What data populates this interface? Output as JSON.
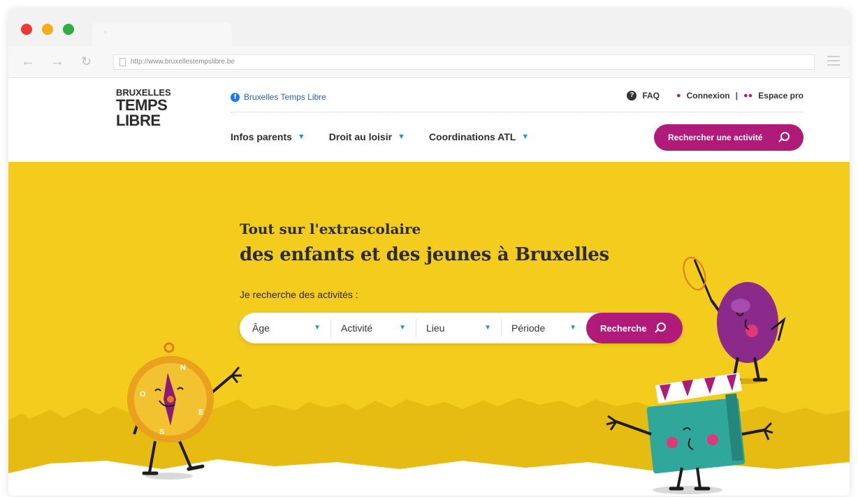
{
  "browser": {
    "url": "http://www.bruxellestempslibre.be"
  },
  "header": {
    "logo": {
      "line1": "BRUXELLES",
      "line2": "TEMPS",
      "line3": "LIBRE"
    },
    "facebook_label": "Bruxelles Temps Libre",
    "links": {
      "faq": "FAQ",
      "login": "Connexion",
      "separator": "|",
      "pro": "Espace pro"
    },
    "nav": [
      {
        "label": "Infos parents"
      },
      {
        "label": "Droit au loisir"
      },
      {
        "label": "Coordinations ATL"
      }
    ],
    "cta_label": "Rechercher une activité"
  },
  "hero": {
    "subtitle": "Tout sur l'extrascolaire",
    "title": "des enfants et des jeunes à Bruxelles",
    "search_label": "Je recherche des activités :",
    "fields": {
      "age": "Âge",
      "activity": "Activité",
      "place": "Lieu",
      "period": "Période"
    },
    "search_button": "Recherche"
  },
  "illustrations": {
    "compass_letters": {
      "n": "N",
      "o": "O",
      "e": "E",
      "s": "S"
    }
  },
  "colors": {
    "accent": "#b01a78",
    "hero_bg": "#f4cc1d",
    "chevron": "#1aa39a"
  }
}
